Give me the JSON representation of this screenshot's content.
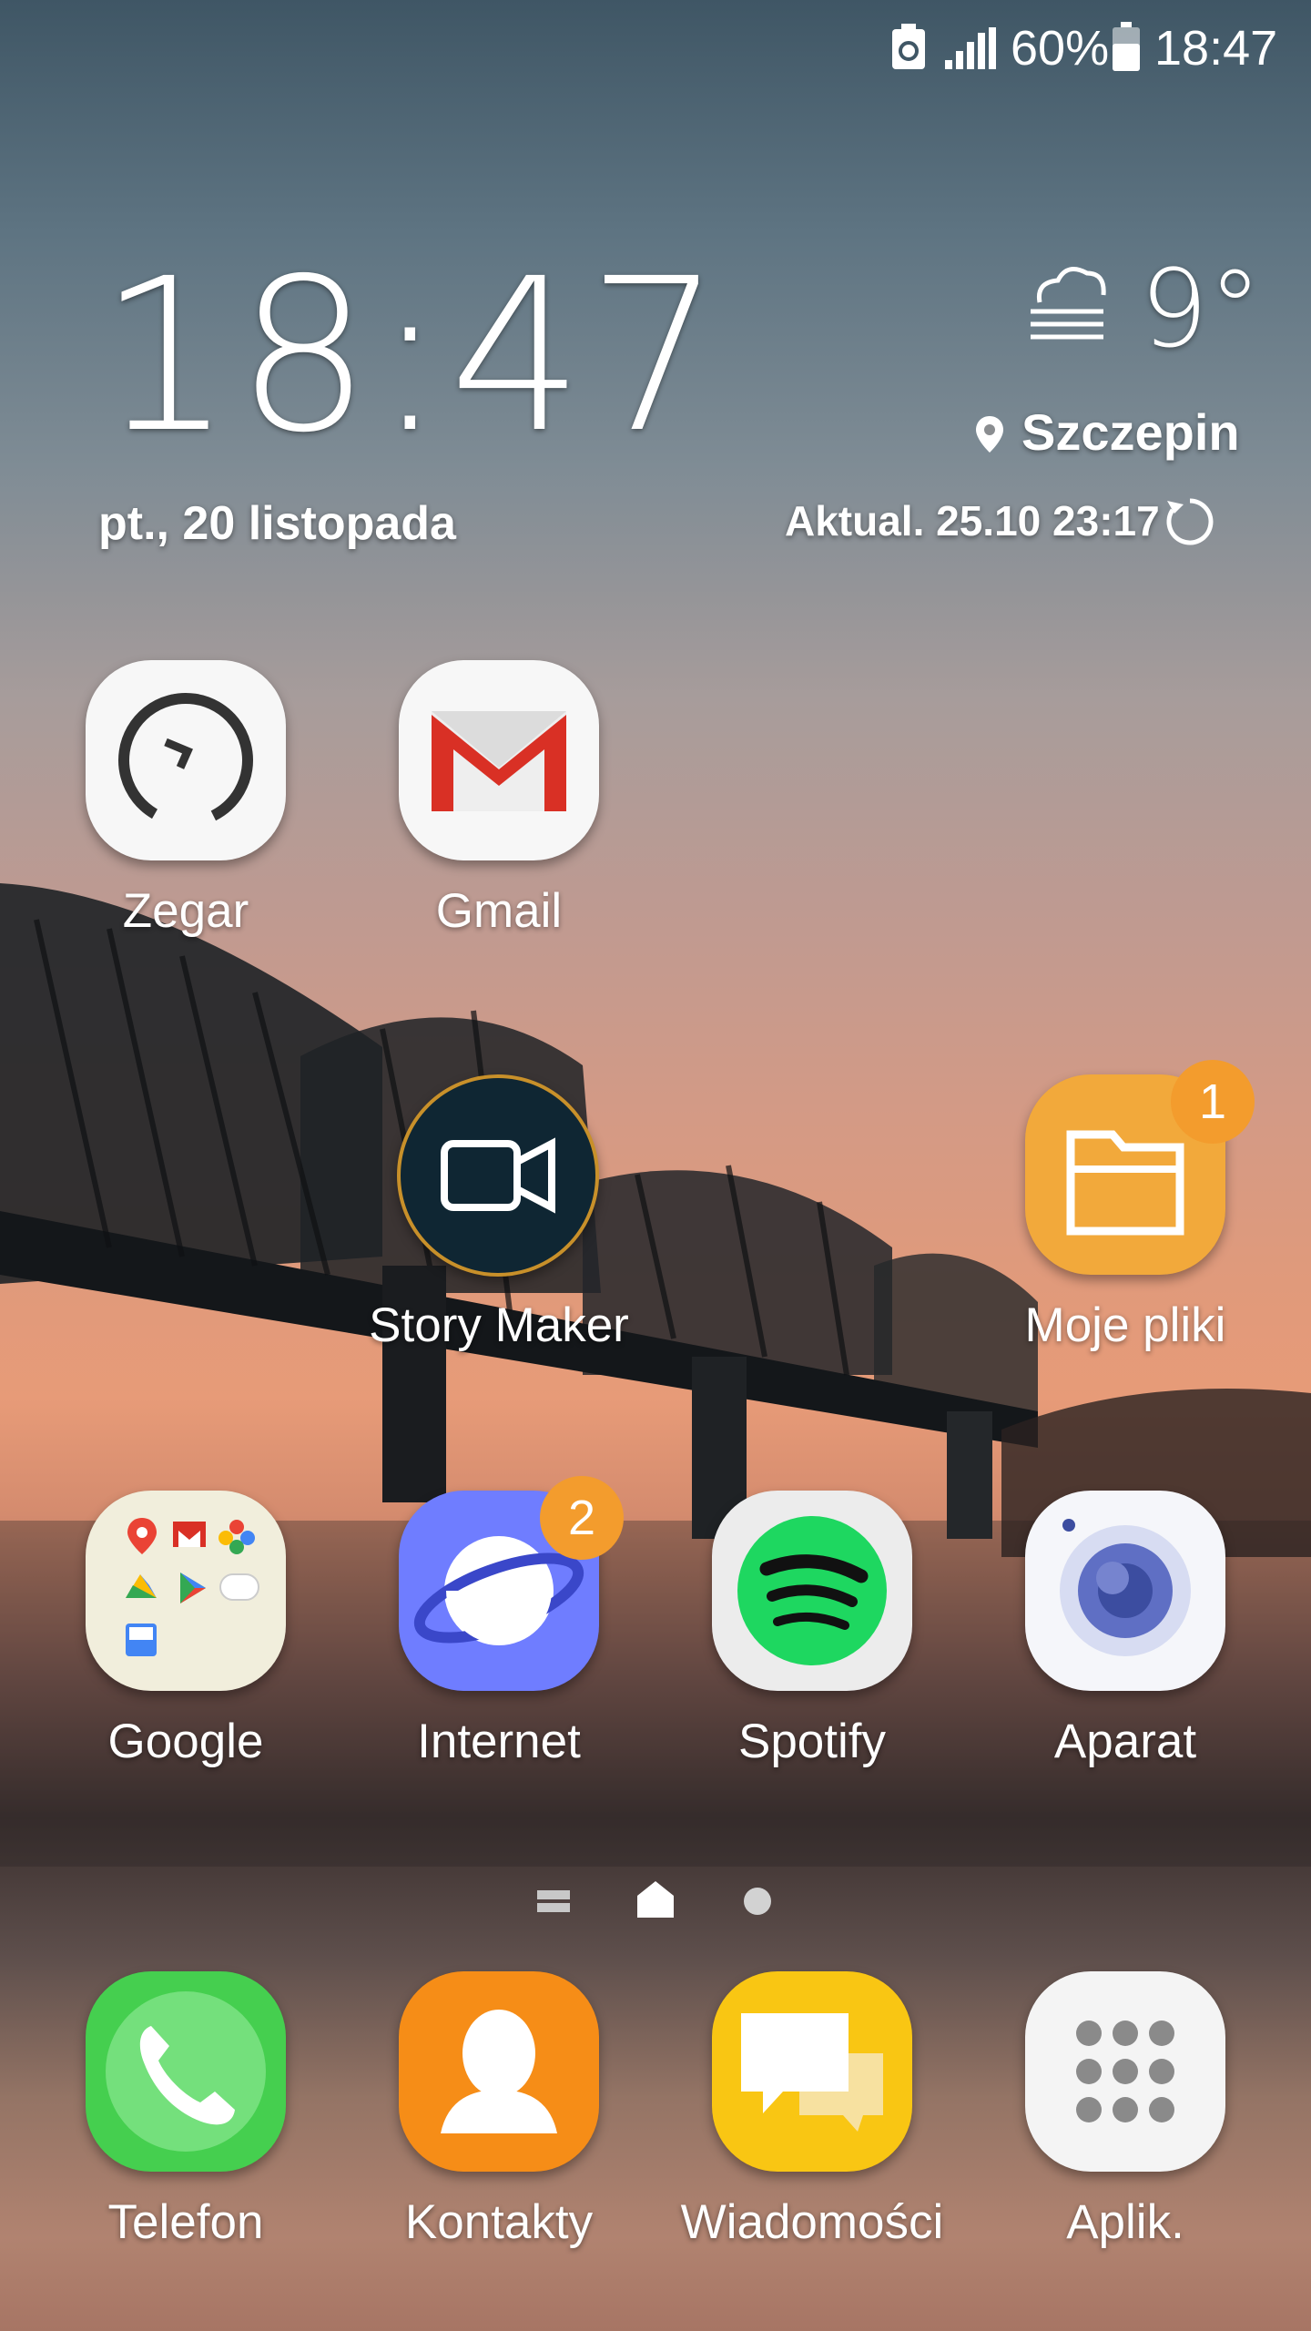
{
  "status_bar": {
    "battery_percent": "60%",
    "time": "18:47"
  },
  "clock_widget": {
    "time": "18:47",
    "date": "pt., 20 listopada"
  },
  "weather_widget": {
    "temperature": "9°",
    "location": "Szczepin",
    "updated": "Aktual. 25.10 23:17"
  },
  "home_apps": [
    {
      "label": "Zegar"
    },
    {
      "label": "Gmail"
    },
    {
      "label": "Story Maker"
    },
    {
      "label": "Moje pliki",
      "badge": "1"
    },
    {
      "label": "Google"
    },
    {
      "label": "Internet",
      "badge": "2"
    },
    {
      "label": "Spotify"
    },
    {
      "label": "Aparat"
    }
  ],
  "dock_apps": [
    {
      "label": "Telefon"
    },
    {
      "label": "Kontakty"
    },
    {
      "label": "Wiadomości"
    },
    {
      "label": "Aplik."
    }
  ]
}
